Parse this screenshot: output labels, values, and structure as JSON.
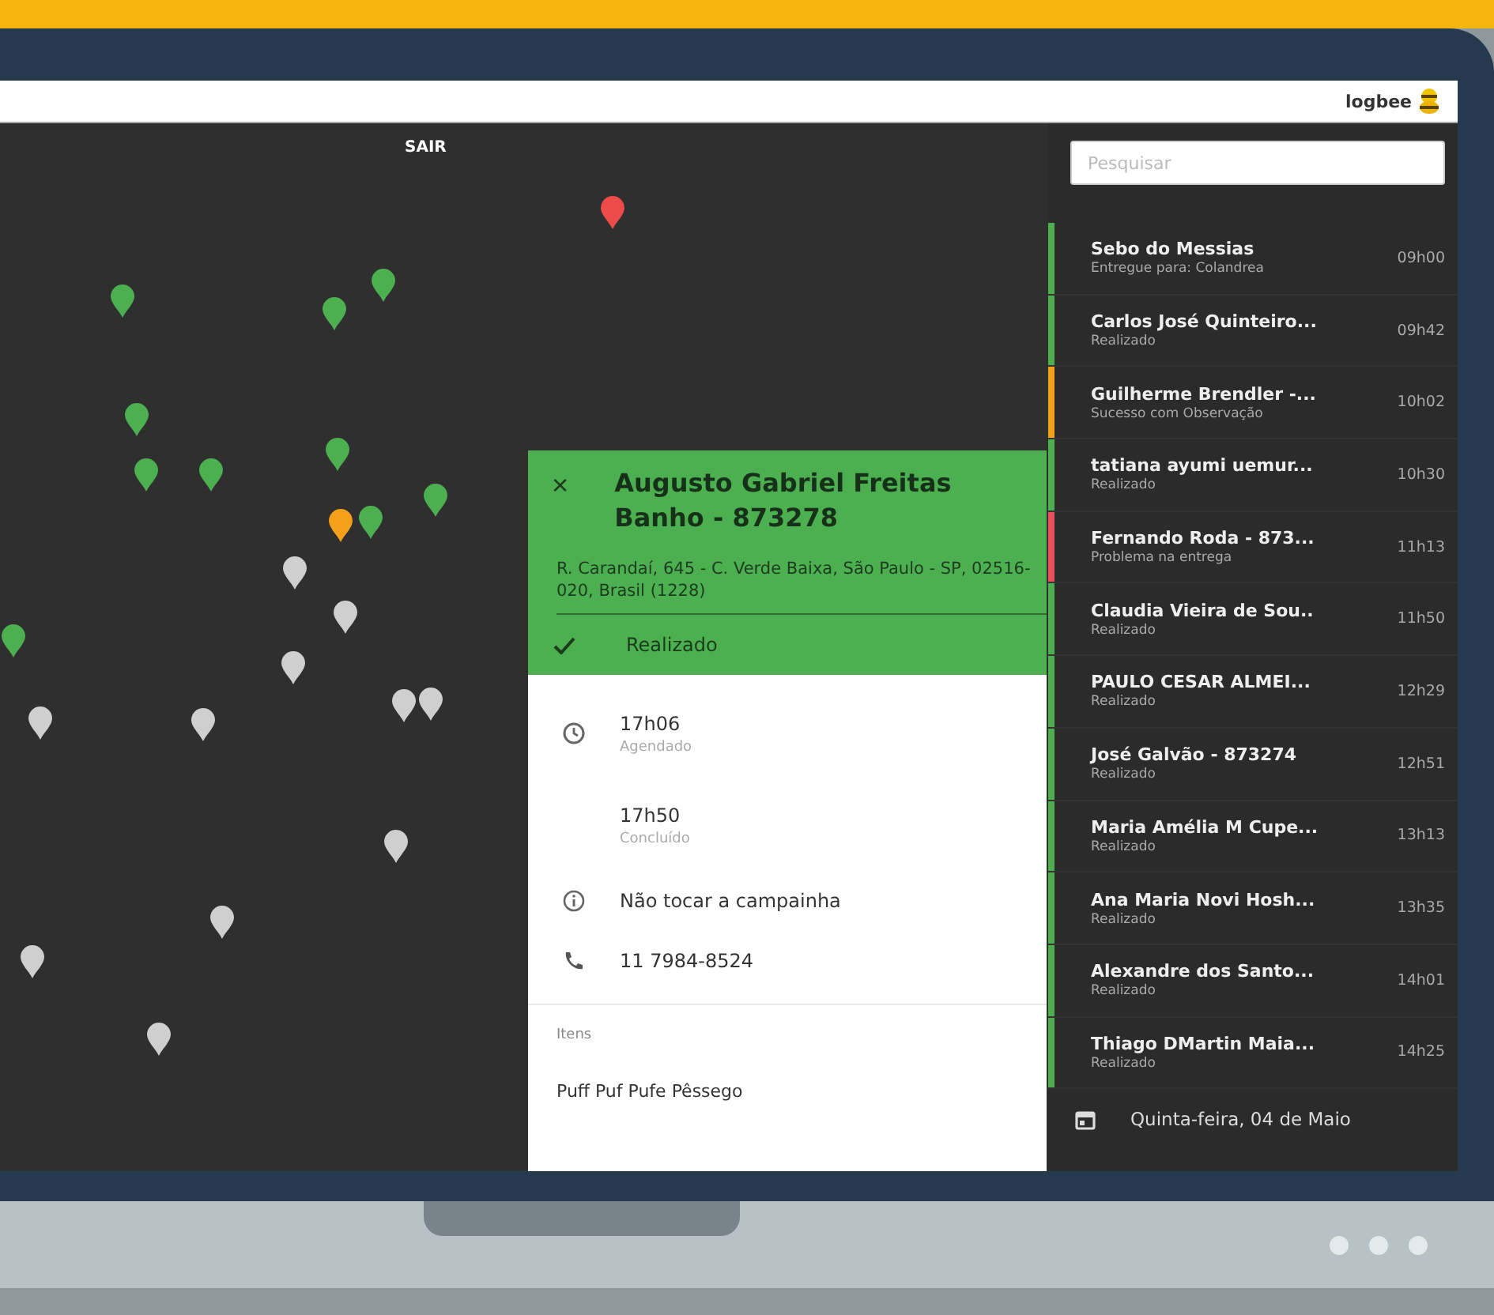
{
  "header": {
    "logo": "logbee"
  },
  "map": {
    "exit_button": "SAIR",
    "pins": [
      {
        "color": "#4caf50"
      },
      {
        "color": "#4caf50"
      },
      {
        "color": "#4caf50"
      },
      {
        "color": "#4caf50"
      },
      {
        "color": "#4caf50"
      },
      {
        "color": "#4caf50"
      },
      {
        "color": "#4caf50"
      },
      {
        "color": "#4caf50"
      },
      {
        "color": "#4caf50"
      },
      {
        "color": "#4caf50"
      },
      {
        "color": "#f5a01a"
      },
      {
        "color": "#ee4b4b"
      },
      {
        "color": "#cfcfcf"
      },
      {
        "color": "#cfcfcf"
      },
      {
        "color": "#cfcfcf"
      },
      {
        "color": "#cfcfcf"
      },
      {
        "color": "#cfcfcf"
      },
      {
        "color": "#cfcfcf"
      },
      {
        "color": "#cfcfcf"
      },
      {
        "color": "#cfcfcf"
      },
      {
        "color": "#cfcfcf"
      },
      {
        "color": "#cfcfcf"
      },
      {
        "color": "#cfcfcf"
      }
    ]
  },
  "detail": {
    "title": "Augusto Gabriel Freitas Banho - 873278",
    "address": "R. Carandaí, 645 - C. Verde Baixa, São Paulo - SP, 02516-020, Brasil (1228)",
    "status": "Realizado",
    "info": [
      {
        "kind": "time",
        "value": "17h06",
        "caption": "Agendado"
      },
      {
        "kind": "plain",
        "value": "17h50",
        "caption": "Concluído"
      },
      {
        "kind": "note",
        "value": "Não tocar a campainha"
      },
      {
        "kind": "phone",
        "value": "11 7984-8524"
      }
    ],
    "items_label": "Itens",
    "items": [
      "Puff Puf Pufe Pêssego"
    ]
  },
  "sidebar": {
    "search": {
      "placeholder": "Pesquisar"
    },
    "deliveries": [
      {
        "name": "Sebo do Messias",
        "status": "Entregue para: Colandrea",
        "time": "09h00",
        "color": "#4caf50"
      },
      {
        "name": "Carlos José Quinteiro...",
        "status": "Realizado",
        "time": "09h42",
        "color": "#4caf50"
      },
      {
        "name": "Guilherme Brendler -...",
        "status": "Sucesso com Observação",
        "time": "10h02",
        "color": "#f5a01a"
      },
      {
        "name": "tatiana ayumi uemur...",
        "status": "Realizado",
        "time": "10h30",
        "color": "#4caf50"
      },
      {
        "name": "Fernando Roda - 873...",
        "status": "Problema na entrega",
        "time": "11h13",
        "color": "#e8505b"
      },
      {
        "name": "Claudia Vieira de Sou..",
        "status": "Realizado",
        "time": "11h50",
        "color": "#4caf50"
      },
      {
        "name": "PAULO CESAR ALMEI...",
        "status": "Realizado",
        "time": "12h29",
        "color": "#4caf50"
      },
      {
        "name": "José Galvão - 873274",
        "status": "Realizado",
        "time": "12h51",
        "color": "#4caf50"
      },
      {
        "name": "Maria Amélia M Cupe...",
        "status": "Realizado",
        "time": "13h13",
        "color": "#4caf50"
      },
      {
        "name": "Ana Maria Novi Hosh...",
        "status": "Realizado",
        "time": "13h35",
        "color": "#4caf50"
      },
      {
        "name": "Alexandre dos Santo...",
        "status": "Realizado",
        "time": "14h01",
        "color": "#4caf50"
      },
      {
        "name": "Thiago DMartin Maia...",
        "status": "Realizado",
        "time": "14h25",
        "color": "#4caf50"
      }
    ],
    "date": "Quinta-feira, 04 de Maio"
  }
}
